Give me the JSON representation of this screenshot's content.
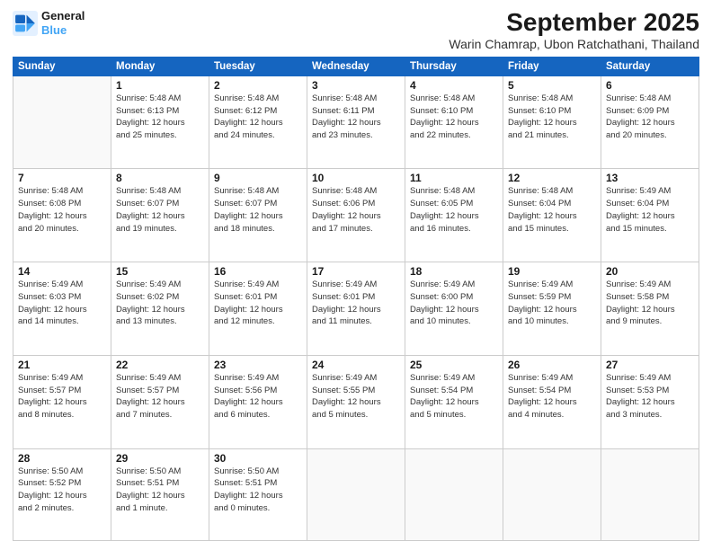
{
  "header": {
    "logo_line1": "General",
    "logo_line2": "Blue",
    "month": "September 2025",
    "location": "Warin Chamrap, Ubon Ratchathani, Thailand"
  },
  "weekdays": [
    "Sunday",
    "Monday",
    "Tuesday",
    "Wednesday",
    "Thursday",
    "Friday",
    "Saturday"
  ],
  "weeks": [
    [
      {
        "day": null
      },
      {
        "day": "1",
        "sunrise": "5:48 AM",
        "sunset": "6:13 PM",
        "daylight": "12 hours and 25 minutes."
      },
      {
        "day": "2",
        "sunrise": "5:48 AM",
        "sunset": "6:12 PM",
        "daylight": "12 hours and 24 minutes."
      },
      {
        "day": "3",
        "sunrise": "5:48 AM",
        "sunset": "6:11 PM",
        "daylight": "12 hours and 23 minutes."
      },
      {
        "day": "4",
        "sunrise": "5:48 AM",
        "sunset": "6:10 PM",
        "daylight": "12 hours and 22 minutes."
      },
      {
        "day": "5",
        "sunrise": "5:48 AM",
        "sunset": "6:10 PM",
        "daylight": "12 hours and 21 minutes."
      },
      {
        "day": "6",
        "sunrise": "5:48 AM",
        "sunset": "6:09 PM",
        "daylight": "12 hours and 20 minutes."
      }
    ],
    [
      {
        "day": "7",
        "sunrise": "5:48 AM",
        "sunset": "6:08 PM",
        "daylight": "12 hours and 20 minutes."
      },
      {
        "day": "8",
        "sunrise": "5:48 AM",
        "sunset": "6:07 PM",
        "daylight": "12 hours and 19 minutes."
      },
      {
        "day": "9",
        "sunrise": "5:48 AM",
        "sunset": "6:07 PM",
        "daylight": "12 hours and 18 minutes."
      },
      {
        "day": "10",
        "sunrise": "5:48 AM",
        "sunset": "6:06 PM",
        "daylight": "12 hours and 17 minutes."
      },
      {
        "day": "11",
        "sunrise": "5:48 AM",
        "sunset": "6:05 PM",
        "daylight": "12 hours and 16 minutes."
      },
      {
        "day": "12",
        "sunrise": "5:48 AM",
        "sunset": "6:04 PM",
        "daylight": "12 hours and 15 minutes."
      },
      {
        "day": "13",
        "sunrise": "5:49 AM",
        "sunset": "6:04 PM",
        "daylight": "12 hours and 15 minutes."
      }
    ],
    [
      {
        "day": "14",
        "sunrise": "5:49 AM",
        "sunset": "6:03 PM",
        "daylight": "12 hours and 14 minutes."
      },
      {
        "day": "15",
        "sunrise": "5:49 AM",
        "sunset": "6:02 PM",
        "daylight": "12 hours and 13 minutes."
      },
      {
        "day": "16",
        "sunrise": "5:49 AM",
        "sunset": "6:01 PM",
        "daylight": "12 hours and 12 minutes."
      },
      {
        "day": "17",
        "sunrise": "5:49 AM",
        "sunset": "6:01 PM",
        "daylight": "12 hours and 11 minutes."
      },
      {
        "day": "18",
        "sunrise": "5:49 AM",
        "sunset": "6:00 PM",
        "daylight": "12 hours and 10 minutes."
      },
      {
        "day": "19",
        "sunrise": "5:49 AM",
        "sunset": "5:59 PM",
        "daylight": "12 hours and 10 minutes."
      },
      {
        "day": "20",
        "sunrise": "5:49 AM",
        "sunset": "5:58 PM",
        "daylight": "12 hours and 9 minutes."
      }
    ],
    [
      {
        "day": "21",
        "sunrise": "5:49 AM",
        "sunset": "5:57 PM",
        "daylight": "12 hours and 8 minutes."
      },
      {
        "day": "22",
        "sunrise": "5:49 AM",
        "sunset": "5:57 PM",
        "daylight": "12 hours and 7 minutes."
      },
      {
        "day": "23",
        "sunrise": "5:49 AM",
        "sunset": "5:56 PM",
        "daylight": "12 hours and 6 minutes."
      },
      {
        "day": "24",
        "sunrise": "5:49 AM",
        "sunset": "5:55 PM",
        "daylight": "12 hours and 5 minutes."
      },
      {
        "day": "25",
        "sunrise": "5:49 AM",
        "sunset": "5:54 PM",
        "daylight": "12 hours and 5 minutes."
      },
      {
        "day": "26",
        "sunrise": "5:49 AM",
        "sunset": "5:54 PM",
        "daylight": "12 hours and 4 minutes."
      },
      {
        "day": "27",
        "sunrise": "5:49 AM",
        "sunset": "5:53 PM",
        "daylight": "12 hours and 3 minutes."
      }
    ],
    [
      {
        "day": "28",
        "sunrise": "5:50 AM",
        "sunset": "5:52 PM",
        "daylight": "12 hours and 2 minutes."
      },
      {
        "day": "29",
        "sunrise": "5:50 AM",
        "sunset": "5:51 PM",
        "daylight": "12 hours and 1 minute."
      },
      {
        "day": "30",
        "sunrise": "5:50 AM",
        "sunset": "5:51 PM",
        "daylight": "12 hours and 0 minutes."
      },
      {
        "day": null
      },
      {
        "day": null
      },
      {
        "day": null
      },
      {
        "day": null
      }
    ]
  ]
}
